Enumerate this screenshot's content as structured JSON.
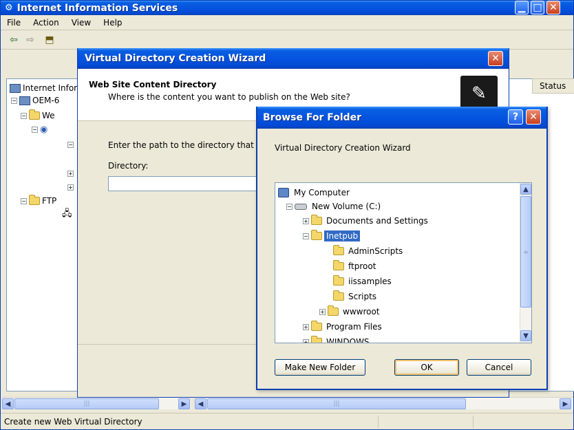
{
  "main_window": {
    "title": "Internet Information Services",
    "menu": [
      "File",
      "Action",
      "View",
      "Help"
    ],
    "tree": [
      {
        "label": "Internet Information Services"
      },
      {
        "label": "OEM-6"
      },
      {
        "label": "We"
      },
      {
        "label": "FTP"
      }
    ],
    "status_column_header": "Status",
    "status_bar_text": "Create new Web Virtual Directory"
  },
  "wizard": {
    "title": "Virtual Directory Creation Wizard",
    "heading": "Web Site Content Directory",
    "subheading": "Where is the content you want to publish on the Web site?",
    "instruction": "Enter the path to the directory that",
    "directory_label": "Directory:",
    "directory_value": ""
  },
  "browse_dialog": {
    "title": "Browse For Folder",
    "description": "Virtual Directory Creation Wizard",
    "tree": {
      "root": "My Computer",
      "drive": "New Volume (C:)",
      "documents": "Documents and Settings",
      "inetpub": "Inetpub",
      "adminscripts": "AdminScripts",
      "ftproot": "ftproot",
      "iissamples": "iissamples",
      "scripts": "Scripts",
      "wwwroot": "wwwroot",
      "program_files": "Program Files",
      "windows_partial": "WINDOWS"
    },
    "selected_folder": "Inetpub",
    "buttons": {
      "make_new_folder": "Make New Folder",
      "ok": "OK",
      "cancel": "Cancel"
    }
  },
  "colors": {
    "title_blue": "#0554e0",
    "selection_blue": "#316ac5",
    "close_red": "#c8401f",
    "dialog_bg": "#ece9d8"
  }
}
